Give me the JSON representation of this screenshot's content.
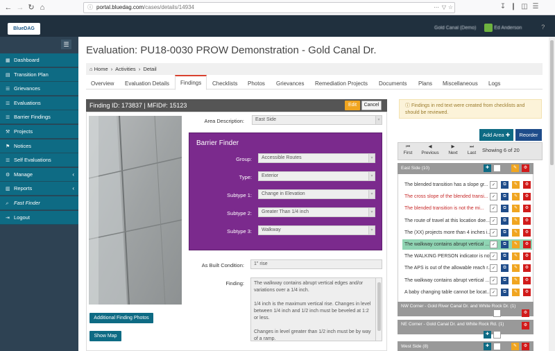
{
  "browser": {
    "url_host": "portal.bluedag.com",
    "url_path": "/cases/details/14934"
  },
  "header": {
    "logo": "BlueDAG",
    "org": "Gold Canal (Demo)",
    "user": "Ed Anderson"
  },
  "sidebar": {
    "items": [
      {
        "label": "Dashboard",
        "icon": "dashboard-icon",
        "chevron": false
      },
      {
        "label": "Transition Plan",
        "icon": "document-icon",
        "chevron": false
      },
      {
        "label": "Grievances",
        "icon": "list-icon",
        "chevron": false
      },
      {
        "label": "Evaluations",
        "icon": "list-icon",
        "chevron": false
      },
      {
        "label": "Barrier Findings",
        "icon": "list-icon",
        "chevron": false
      },
      {
        "label": "Projects",
        "icon": "wrench-icon",
        "chevron": false
      },
      {
        "label": "Notices",
        "icon": "pin-icon",
        "chevron": false
      },
      {
        "label": "Self Evaluations",
        "icon": "list-icon",
        "chevron": false
      },
      {
        "label": "Manage",
        "icon": "gear-icon",
        "chevron": true
      },
      {
        "label": "Reports",
        "icon": "chart-icon",
        "chevron": true
      },
      {
        "label": "Fast Finder",
        "icon": "search-icon",
        "chevron": false
      },
      {
        "label": "Logout",
        "icon": "logout-icon",
        "chevron": false
      }
    ]
  },
  "page": {
    "title": "Evaluation: PU18-0030  PROW Demonstration - Gold Canal Dr.",
    "breadcrumb": [
      "Home",
      "Activities",
      "Detail"
    ],
    "tabs": [
      "Overview",
      "Evaluation Details",
      "Findings",
      "Checklists",
      "Photos",
      "Grievances",
      "Remediation Projects",
      "Documents",
      "Plans",
      "Miscellaneous",
      "Logs"
    ],
    "active_tab": "Findings"
  },
  "finding": {
    "header": "Finding ID: 173837 | MFID#: 15123",
    "edit_label": "Edit",
    "cancel_label": "Cancel",
    "area_label": "Area Description:",
    "area_value": "East Side",
    "barrier_title": "Barrier Finder",
    "group_label": "Group:",
    "group_value": "Accessible Routes",
    "type_label": "Type:",
    "type_value": "Exterior",
    "subtype1_label": "Subtype 1:",
    "subtype1_value": "Change in Elevation",
    "subtype2_label": "Subtype 2:",
    "subtype2_value": "Greater Than 1/4 inch",
    "subtype3_label": "Subtype 3:",
    "subtype3_value": "Walkway",
    "asbuilt_label": "As Built Condition:",
    "asbuilt_value": "1\" rise",
    "finding_label": "Finding:",
    "finding_text_1": "The walkway contains abrupt vertical edges and/or variations over a 1/4 inch.",
    "finding_text_2": "1/4 inch is the maximum vertical rise. Changes in level between 1/4 inch and 1/2 inch must be beveled at 1:2 or less.",
    "finding_text_3": "Changes in level greater than 1/2 inch must be by way of a ramp.",
    "additional_photos_label": "Additional Finding Photos",
    "show_map_label": "Show Map"
  },
  "right": {
    "note": "Findings in red text were created from checklists and should be reviewed.",
    "add_area_label": "Add Area",
    "reorder_label": "Reorder",
    "pager": [
      "First",
      "Previous",
      "Next",
      "Last"
    ],
    "showing": "Showing 6 of 20",
    "areas": [
      {
        "title": "East Side (10)"
      },
      {
        "title": "NW Corner - Gold River Canal Dr. and White Rock Dr. (1)"
      },
      {
        "title": "NE Corner - Gold Canal Dr. and White Rock Rd. (1)"
      },
      {
        "title": "West Side (8)"
      }
    ],
    "items": [
      {
        "text": "The blended transition has a slope gr...",
        "style": "normal"
      },
      {
        "text": "The cross slope of the blended transi...",
        "style": "red"
      },
      {
        "text": "The blended transition is not the mi...",
        "style": "red"
      },
      {
        "text": "The route of travel at this location doe...",
        "style": "normal"
      },
      {
        "text": "The (XX) projects more than 4 inches i...",
        "style": "normal"
      },
      {
        "text": "The walkway contains abrupt vertical ...",
        "style": "selected"
      },
      {
        "text": "The WALKING PERSON indicator is not...",
        "style": "normal"
      },
      {
        "text": "The APS is out of the allowable reach r...",
        "style": "normal"
      },
      {
        "text": "The walkway contains abrupt vertical ...",
        "style": "normal"
      },
      {
        "text": "A baby changing table cannot be locat...",
        "style": "normal"
      }
    ]
  }
}
